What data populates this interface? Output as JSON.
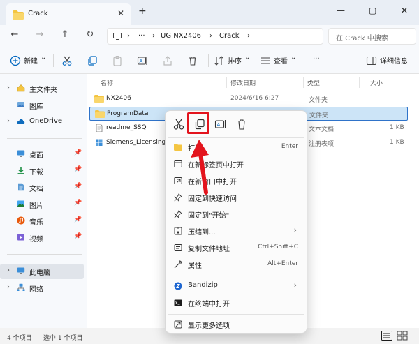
{
  "tab": {
    "title": "Crack",
    "close_glyph": "✕",
    "new_glyph": "+"
  },
  "window_controls": {
    "minimize": "—",
    "maximize": "▢",
    "close": "✕"
  },
  "nav": {
    "back": "←",
    "forward": "→",
    "up": "↑",
    "refresh": "↻",
    "more": "···"
  },
  "address": {
    "crumb1": "UG NX2406",
    "crumb2": "Crack",
    "chevron": "›"
  },
  "search": {
    "placeholder": "在 Crack 中搜索"
  },
  "toolbar": {
    "new_label": "新建",
    "sort_label": "排序",
    "view_label": "查看",
    "more": "···",
    "details_label": "详细信息",
    "dropdown": "⌄"
  },
  "sidebar": {
    "items": [
      {
        "label": "主文件夹",
        "icon": "home-icon"
      },
      {
        "label": "图库",
        "icon": "gallery-icon"
      },
      {
        "label": "OneDrive",
        "icon": "cloud-icon"
      },
      {
        "label": "桌面",
        "icon": "desktop-icon"
      },
      {
        "label": "下载",
        "icon": "download-icon"
      },
      {
        "label": "文档",
        "icon": "document-icon"
      },
      {
        "label": "图片",
        "icon": "picture-icon"
      },
      {
        "label": "音乐",
        "icon": "music-icon"
      },
      {
        "label": "视频",
        "icon": "video-icon"
      },
      {
        "label": "此电脑",
        "icon": "computer-icon"
      },
      {
        "label": "网络",
        "icon": "network-icon"
      }
    ],
    "pin_glyph": "📌"
  },
  "columns": {
    "name": "名称",
    "date": "修改日期",
    "type": "类型",
    "size": "大小"
  },
  "files": [
    {
      "name": "NX2406",
      "date": "2024/6/16 6:27",
      "type": "文件夹",
      "size": ""
    },
    {
      "name": "ProgramData",
      "date": "",
      "type": "文件夹",
      "size": ""
    },
    {
      "name": "readme_SSQ",
      "date": "",
      "type": "文本文档",
      "size": "1 KB"
    },
    {
      "name": "Siemens_Licensing_S",
      "date": "",
      "type": "注册表项",
      "size": "1 KB"
    }
  ],
  "status": {
    "count": "4 个项目",
    "selected": "选中 1 个项目"
  },
  "context_menu": {
    "items": [
      {
        "label": "打开",
        "shortcut": "Enter"
      },
      {
        "label": "在新标签页中打开",
        "shortcut": ""
      },
      {
        "label": "在新窗口中打开",
        "shortcut": ""
      },
      {
        "label": "固定到快速访问",
        "shortcut": ""
      },
      {
        "label": "固定到\"开始\"",
        "shortcut": ""
      },
      {
        "label": "压缩到...",
        "shortcut": ""
      },
      {
        "label": "复制文件地址",
        "shortcut": "Ctrl+Shift+C"
      },
      {
        "label": "属性",
        "shortcut": "Alt+Enter"
      },
      {
        "label": "Bandizip",
        "shortcut": ""
      },
      {
        "label": "在终端中打开",
        "shortcut": ""
      },
      {
        "label": "显示更多选项",
        "shortcut": ""
      }
    ],
    "submenu_arrow": "›"
  },
  "colors": {
    "accent": "#0067c0",
    "highlight": "#e3141d",
    "selection": "#cce4f7",
    "folder": "#f4c542"
  }
}
